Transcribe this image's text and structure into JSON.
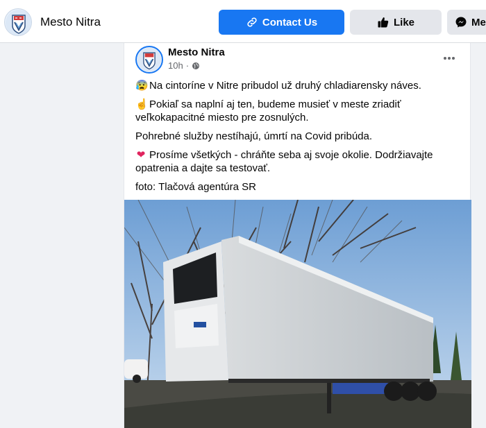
{
  "header": {
    "page_name": "Mesto Nitra",
    "contact_label": "Contact Us",
    "like_label": "Like",
    "message_label": "Me"
  },
  "post": {
    "author": "Mesto Nitra",
    "time": "10h",
    "lines": [
      {
        "icon": "😰",
        "text": "Na cintoríne v Nitre pribudol už druhý chladiarensky náves."
      },
      {
        "icon": "☝",
        "text": "Pokiaľ sa naplní aj ten, budeme musieť v meste zriadiť veľkokapacitné miesto pre zosnulých."
      },
      {
        "icon": "",
        "text": "Pohrebné služby nestíhajú, úmrtí na Covid pribúda."
      },
      {
        "icon": "❤",
        "text": "Prosíme všetkých - chráňte seba aj svoje okolie. Dodržiavajte opatrenia a dajte sa testovať."
      },
      {
        "icon": "",
        "text": "foto: Tlačová agentúra SR"
      }
    ]
  },
  "colors": {
    "accent": "#1877f2",
    "background": "#f0f2f5",
    "secondary_text": "#65676b"
  },
  "icons": {
    "contact": "link-icon",
    "like": "thumbs-up-icon",
    "message": "messenger-icon",
    "privacy": "globe-icon",
    "more": "more-dots-icon"
  }
}
